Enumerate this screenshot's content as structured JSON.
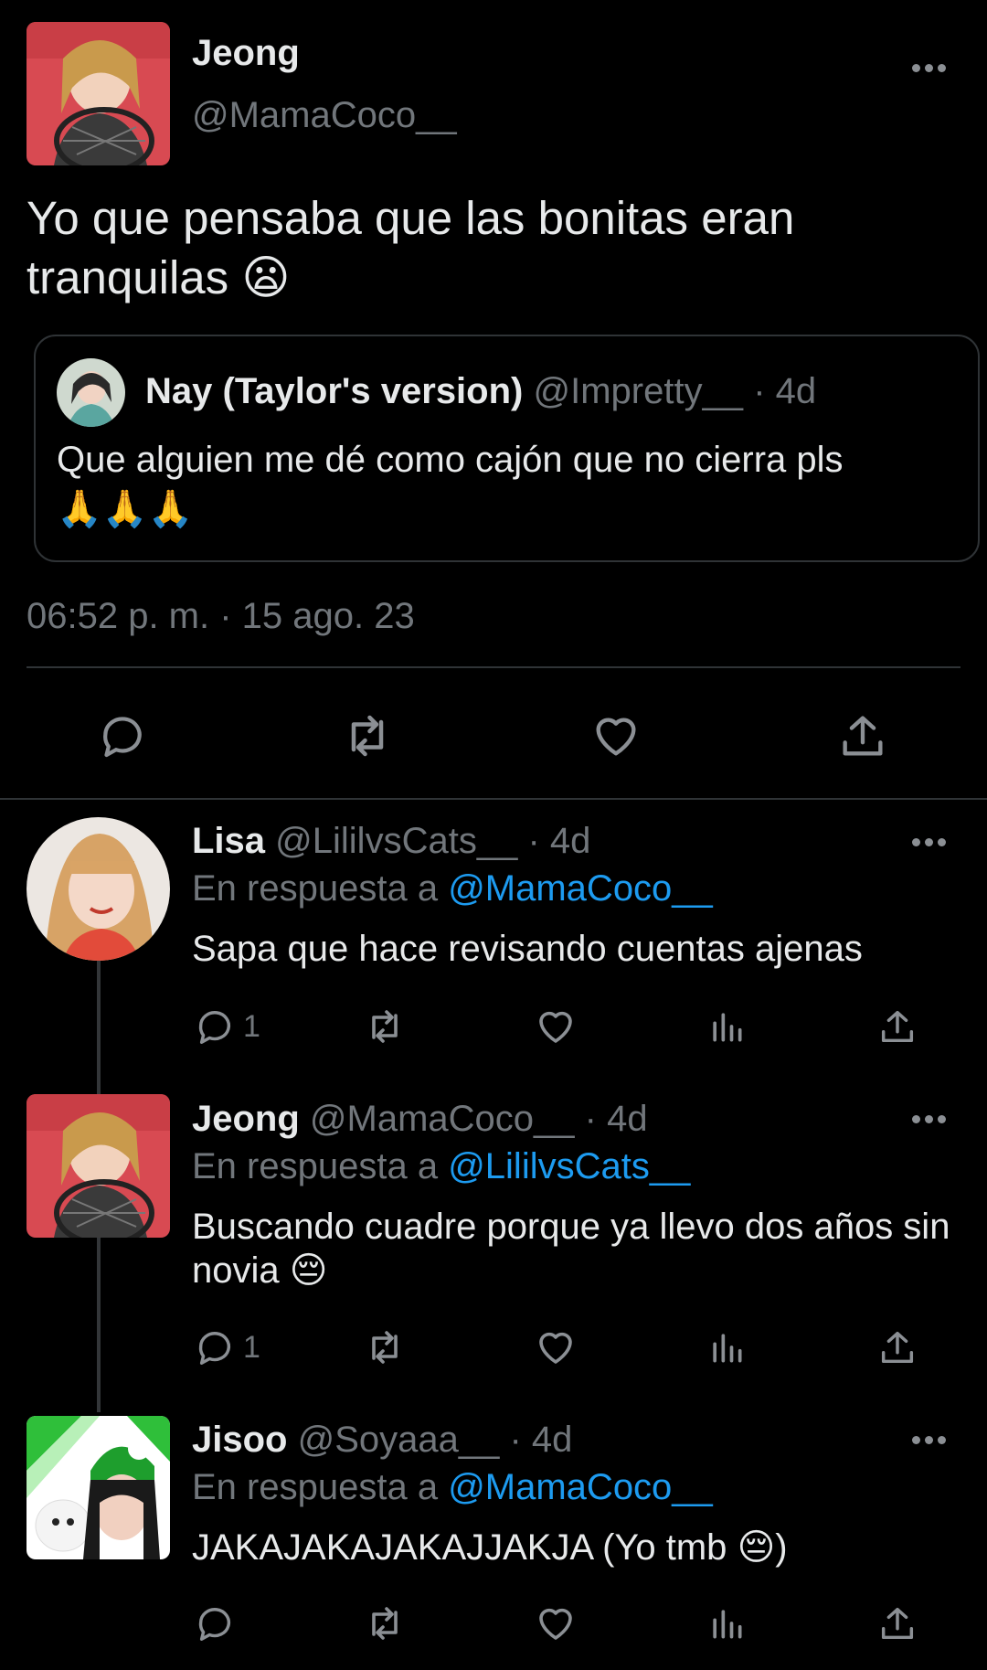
{
  "main_tweet": {
    "name": "Jeong",
    "handle": "@MamaCoco__",
    "text": "Yo que pensaba que las bonitas eran tranquilas",
    "emoji": "😦",
    "timestamp": "06:52 p. m. · 15 ago. 23",
    "quote": {
      "name": "Nay (Taylor's version)",
      "handle": "@Impretty__",
      "time": "· 4d",
      "text": "Que alguien me dé como cajón que no cierra pls",
      "emoji": "🙏🙏🙏"
    },
    "actions": [
      "reply-icon",
      "retweet-icon",
      "like-icon",
      "share-icon"
    ]
  },
  "replies": [
    {
      "name": "Lisa",
      "handle": "@LililvsCats__",
      "time": "· 4d",
      "reply_prefix": "En respuesta a",
      "reply_to": "@MamaCoco__",
      "text": "Sapa que hace revisando cuentas ajenas",
      "emoji": "",
      "reply_count": "1"
    },
    {
      "name": "Jeong",
      "handle": "@MamaCoco__",
      "time": "· 4d",
      "reply_prefix": "En respuesta a",
      "reply_to": "@LililvsCats__",
      "text": "Buscando cuadre porque ya llevo dos años sin novia",
      "emoji": "😔",
      "reply_count": "1"
    },
    {
      "name": "Jisoo",
      "handle": "@Soyaaa__",
      "time": "· 4d",
      "reply_prefix": "En respuesta a",
      "reply_to": "@MamaCoco__",
      "text": "JAKAJAKAJAKAJJAKJA (Yo tmb",
      "emoji": "😔",
      "text_end": ")",
      "reply_count": ""
    }
  ],
  "colors": {
    "background": "#000000",
    "text": "#e7e9ea",
    "muted": "#71767b",
    "link": "#1d9bf0",
    "divider": "#2f3336"
  }
}
